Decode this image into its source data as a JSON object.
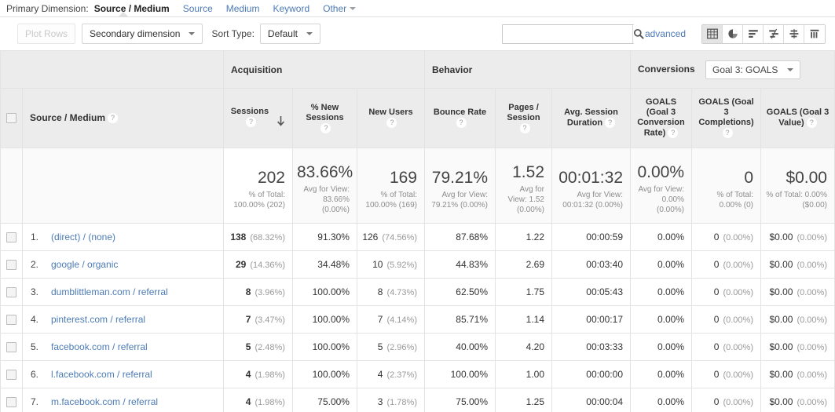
{
  "primary_dimension": {
    "label": "Primary Dimension:",
    "tabs": [
      {
        "name": "Source / Medium",
        "active": true
      },
      {
        "name": "Source",
        "active": false
      },
      {
        "name": "Medium",
        "active": false
      },
      {
        "name": "Keyword",
        "active": false
      },
      {
        "name": "Other",
        "active": false,
        "has_caret": true
      }
    ]
  },
  "toolbar": {
    "plot_rows_label": "Plot Rows",
    "secondary_dimension_label": "Secondary dimension",
    "sort_type_label": "Sort Type:",
    "sort_type_value": "Default",
    "search_value": "",
    "search_placeholder": "",
    "advanced_label": "advanced",
    "view_buttons": [
      {
        "icon": "table-view-icon",
        "active": true
      },
      {
        "icon": "pie-chart-view-icon",
        "active": false
      },
      {
        "icon": "bar-chart-view-icon",
        "active": false
      },
      {
        "icon": "performance-view-icon",
        "active": false
      },
      {
        "icon": "comparison-view-icon",
        "active": false
      },
      {
        "icon": "pivot-view-icon",
        "active": false
      }
    ]
  },
  "table": {
    "groups": {
      "dimension": "",
      "acquisition": "Acquisition",
      "behavior": "Behavior",
      "conversions": "Conversions",
      "goal_selector": "Goal 3: GOALS"
    },
    "columns": [
      {
        "label": "Source / Medium",
        "help": true,
        "sorted": false
      },
      {
        "label": "Sessions",
        "help": true,
        "sorted": true,
        "sort_dir": "desc"
      },
      {
        "label": "% New Sessions",
        "help": true,
        "sorted": false
      },
      {
        "label": "New Users",
        "help": true,
        "sorted": false
      },
      {
        "label": "Bounce Rate",
        "help": true,
        "sorted": false
      },
      {
        "label": "Pages / Session",
        "help": true,
        "sorted": false
      },
      {
        "label": "Avg. Session Duration",
        "help": true,
        "sorted": false
      },
      {
        "label": "GOALS (Goal 3 Conversion Rate)",
        "help": true,
        "sorted": false
      },
      {
        "label": "GOALS (Goal 3 Completions)",
        "help": true,
        "sorted": false
      },
      {
        "label": "GOALS (Goal 3 Value)",
        "help": true,
        "sorted": false
      }
    ],
    "summary": [
      {
        "big": "202",
        "sub": "% of Total: 100.00% (202)"
      },
      {
        "big": "83.66%",
        "sub": "Avg for View: 83.66% (0.00%)"
      },
      {
        "big": "169",
        "sub": "% of Total: 100.00% (169)"
      },
      {
        "big": "79.21%",
        "sub": "Avg for View: 79.21% (0.00%)"
      },
      {
        "big": "1.52",
        "sub": "Avg for View: 1.52 (0.00%)"
      },
      {
        "big": "00:01:32",
        "sub": "Avg for View: 00:01:32 (0.00%)"
      },
      {
        "big": "0.00%",
        "sub": "Avg for View: 0.00% (0.00%)"
      },
      {
        "big": "0",
        "sub": "% of Total: 0.00% (0)"
      },
      {
        "big": "$0.00",
        "sub": "% of Total: 0.00% ($0.00)"
      }
    ],
    "rows": [
      {
        "index": "1.",
        "source": "(direct) / (none)",
        "sessions": "138",
        "sessions_pct": "(68.32%)",
        "new_sessions_pct": "91.30%",
        "new_users": "126",
        "new_users_pct": "(74.56%)",
        "bounce_rate": "87.68%",
        "pages_session": "1.22",
        "avg_duration": "00:00:59",
        "goal_conv_rate": "0.00%",
        "goal_completions": "0",
        "goal_completions_pct": "(0.00%)",
        "goal_value": "$0.00",
        "goal_value_pct": "(0.00%)"
      },
      {
        "index": "2.",
        "source": "google / organic",
        "sessions": "29",
        "sessions_pct": "(14.36%)",
        "new_sessions_pct": "34.48%",
        "new_users": "10",
        "new_users_pct": "(5.92%)",
        "bounce_rate": "44.83%",
        "pages_session": "2.69",
        "avg_duration": "00:03:40",
        "goal_conv_rate": "0.00%",
        "goal_completions": "0",
        "goal_completions_pct": "(0.00%)",
        "goal_value": "$0.00",
        "goal_value_pct": "(0.00%)"
      },
      {
        "index": "3.",
        "source": "dumblittleman.com / referral",
        "sessions": "8",
        "sessions_pct": "(3.96%)",
        "new_sessions_pct": "100.00%",
        "new_users": "8",
        "new_users_pct": "(4.73%)",
        "bounce_rate": "62.50%",
        "pages_session": "1.75",
        "avg_duration": "00:05:43",
        "goal_conv_rate": "0.00%",
        "goal_completions": "0",
        "goal_completions_pct": "(0.00%)",
        "goal_value": "$0.00",
        "goal_value_pct": "(0.00%)"
      },
      {
        "index": "4.",
        "source": "pinterest.com / referral",
        "sessions": "7",
        "sessions_pct": "(3.47%)",
        "new_sessions_pct": "100.00%",
        "new_users": "7",
        "new_users_pct": "(4.14%)",
        "bounce_rate": "85.71%",
        "pages_session": "1.14",
        "avg_duration": "00:00:17",
        "goal_conv_rate": "0.00%",
        "goal_completions": "0",
        "goal_completions_pct": "(0.00%)",
        "goal_value": "$0.00",
        "goal_value_pct": "(0.00%)"
      },
      {
        "index": "5.",
        "source": "facebook.com / referral",
        "sessions": "5",
        "sessions_pct": "(2.48%)",
        "new_sessions_pct": "100.00%",
        "new_users": "5",
        "new_users_pct": "(2.96%)",
        "bounce_rate": "40.00%",
        "pages_session": "4.20",
        "avg_duration": "00:03:33",
        "goal_conv_rate": "0.00%",
        "goal_completions": "0",
        "goal_completions_pct": "(0.00%)",
        "goal_value": "$0.00",
        "goal_value_pct": "(0.00%)"
      },
      {
        "index": "6.",
        "source": "l.facebook.com / referral",
        "sessions": "4",
        "sessions_pct": "(1.98%)",
        "new_sessions_pct": "100.00%",
        "new_users": "4",
        "new_users_pct": "(2.37%)",
        "bounce_rate": "100.00%",
        "pages_session": "1.00",
        "avg_duration": "00:00:00",
        "goal_conv_rate": "0.00%",
        "goal_completions": "0",
        "goal_completions_pct": "(0.00%)",
        "goal_value": "$0.00",
        "goal_value_pct": "(0.00%)"
      },
      {
        "index": "7.",
        "source": "m.facebook.com / referral",
        "sessions": "4",
        "sessions_pct": "(1.98%)",
        "new_sessions_pct": "75.00%",
        "new_users": "3",
        "new_users_pct": "(1.78%)",
        "bounce_rate": "75.00%",
        "pages_session": "1.25",
        "avg_duration": "00:00:04",
        "goal_conv_rate": "0.00%",
        "goal_completions": "0",
        "goal_completions_pct": "(0.00%)",
        "goal_value": "$0.00",
        "goal_value_pct": "(0.00%)"
      }
    ]
  },
  "colors": {
    "link": "#4d7bb5",
    "header_bg": "#ececec",
    "summary_bg": "#fafafa",
    "border": "#e3e3e3"
  }
}
